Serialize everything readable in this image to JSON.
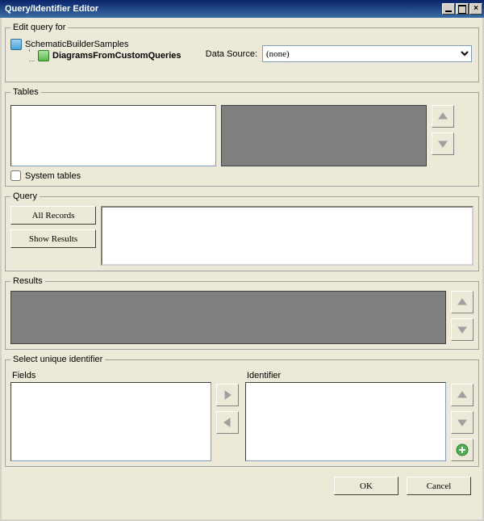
{
  "title": "Query/Identifier Editor",
  "editQuery": {
    "legend": "Edit query for",
    "tree": {
      "root": "SchematicBuilderSamples",
      "child": "DiagramsFromCustomQueries"
    },
    "dataSourceLabel": "Data Source:",
    "dataSourceValue": "(none)"
  },
  "tables": {
    "legend": "Tables",
    "systemTablesLabel": "System tables"
  },
  "query": {
    "legend": "Query",
    "allRecords": "All Records",
    "showResults": "Show Results",
    "text": ""
  },
  "results": {
    "legend": "Results"
  },
  "selectIdent": {
    "legend": "Select unique identifier",
    "fieldsLabel": "Fields",
    "identifierLabel": "Identifier"
  },
  "footer": {
    "ok": "OK",
    "cancel": "Cancel"
  }
}
